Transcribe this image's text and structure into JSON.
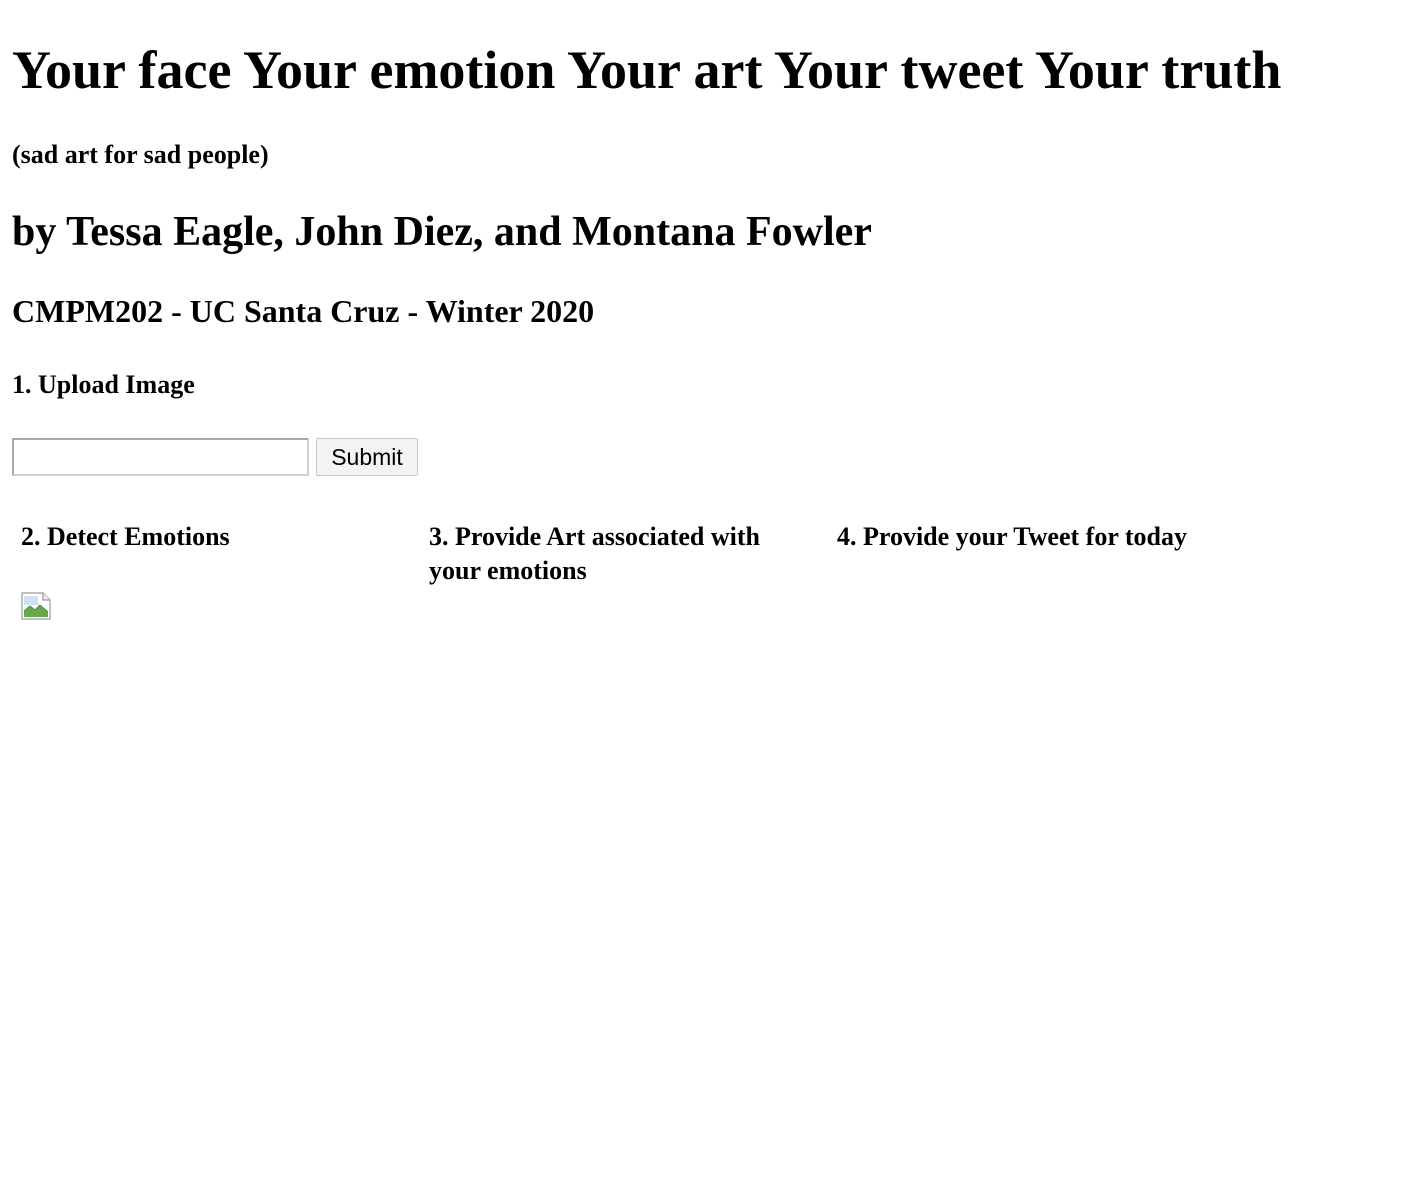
{
  "header": {
    "title": "Your face Your emotion Your art Your tweet Your truth",
    "subtitle": "(sad art for sad people)",
    "authors": "by Tessa Eagle, John Diez, and Montana Fowler",
    "course": "CMPM202 - UC Santa Cruz - Winter 2020"
  },
  "upload": {
    "heading": "1. Upload Image",
    "input_value": "",
    "submit_label": "Submit"
  },
  "steps": {
    "detect": "2. Detect Emotions",
    "art": "3. Provide Art associated with your emotions",
    "tweet": "4. Provide your Tweet for today"
  },
  "result_image": {
    "icon": "broken-image-icon"
  }
}
